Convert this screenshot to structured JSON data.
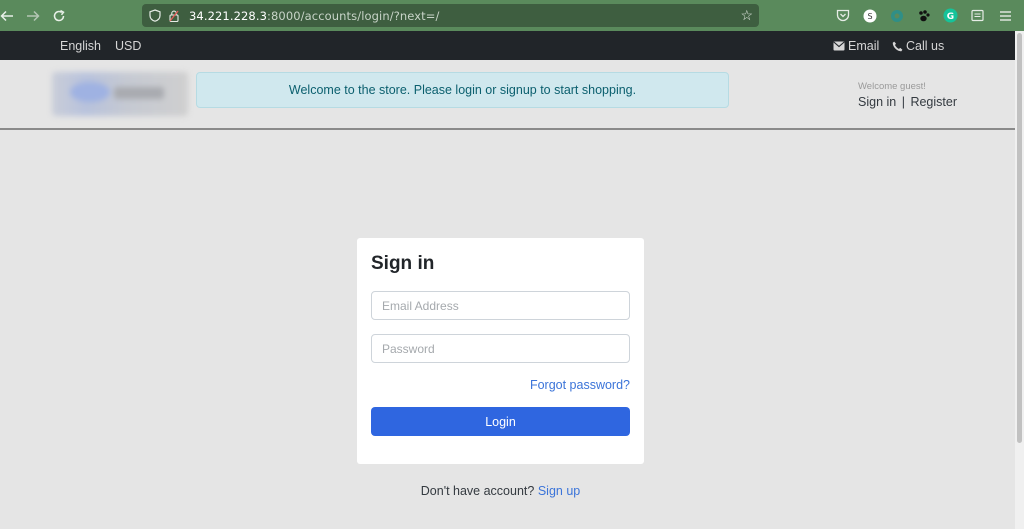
{
  "browser": {
    "url_host": "34.221.228.3",
    "url_path": ":8000/accounts/login/?next=/"
  },
  "topbar": {
    "language": "English",
    "currency": "USD",
    "email_label": "Email",
    "call_label": "Call us"
  },
  "header": {
    "alert_text": "Welcome to the store. Please login or signup to start shopping.",
    "welcome_text": "Welcome guest!",
    "signin_label": "Sign in",
    "separator": "|",
    "register_label": "Register"
  },
  "login": {
    "title": "Sign in",
    "email_placeholder": "Email Address",
    "password_placeholder": "Password",
    "forgot_label": "Forgot password?",
    "login_label": "Login"
  },
  "signup": {
    "prompt": "Don't have account?",
    "link_label": "Sign up"
  },
  "colors": {
    "accent": "#2f66e0",
    "link": "#3b74d9",
    "alert_bg": "#d0e8ee",
    "topbar_bg": "#212529",
    "browser_bg": "#5a8a5c"
  },
  "icons": {
    "back": "arrow-left-icon",
    "forward": "arrow-right-icon",
    "reload": "reload-icon",
    "shield": "shield-icon",
    "lock": "lock-icon",
    "bookmark": "star-icon",
    "email": "envelope-icon",
    "phone": "phone-icon",
    "menu": "hamburger-icon"
  }
}
